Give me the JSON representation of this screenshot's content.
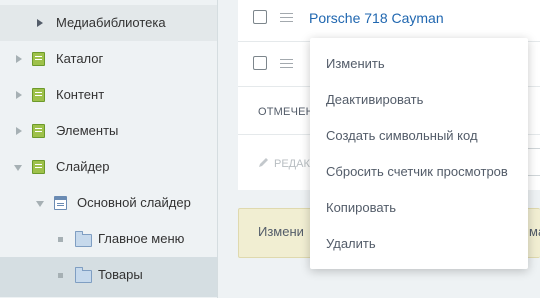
{
  "sidebar": {
    "items": [
      {
        "label": "Медиабиблиотека"
      },
      {
        "label": "Каталог"
      },
      {
        "label": "Контент"
      },
      {
        "label": "Элементы"
      },
      {
        "label": "Слайдер"
      },
      {
        "label": "Основной слайдер"
      },
      {
        "label": "Главное меню"
      },
      {
        "label": "Товары"
      }
    ]
  },
  "list": {
    "row1_title": "Porsche 718 Cayman",
    "selected_label_partial": "ОТМЕЧЕН",
    "edit_label_partial": "РЕДАК",
    "bottom_left_partial": "Измени",
    "bottom_right_partial": "ма"
  },
  "context_menu": {
    "items": [
      "Изменить",
      "Деактивировать",
      "Создать символьный код",
      "Сбросить счетчик просмотров",
      "Копировать",
      "Удалить"
    ]
  },
  "icons": {
    "catalog": "green-catalog-icon",
    "slider_list": "list-doc-icon",
    "section": "folder-icon"
  }
}
